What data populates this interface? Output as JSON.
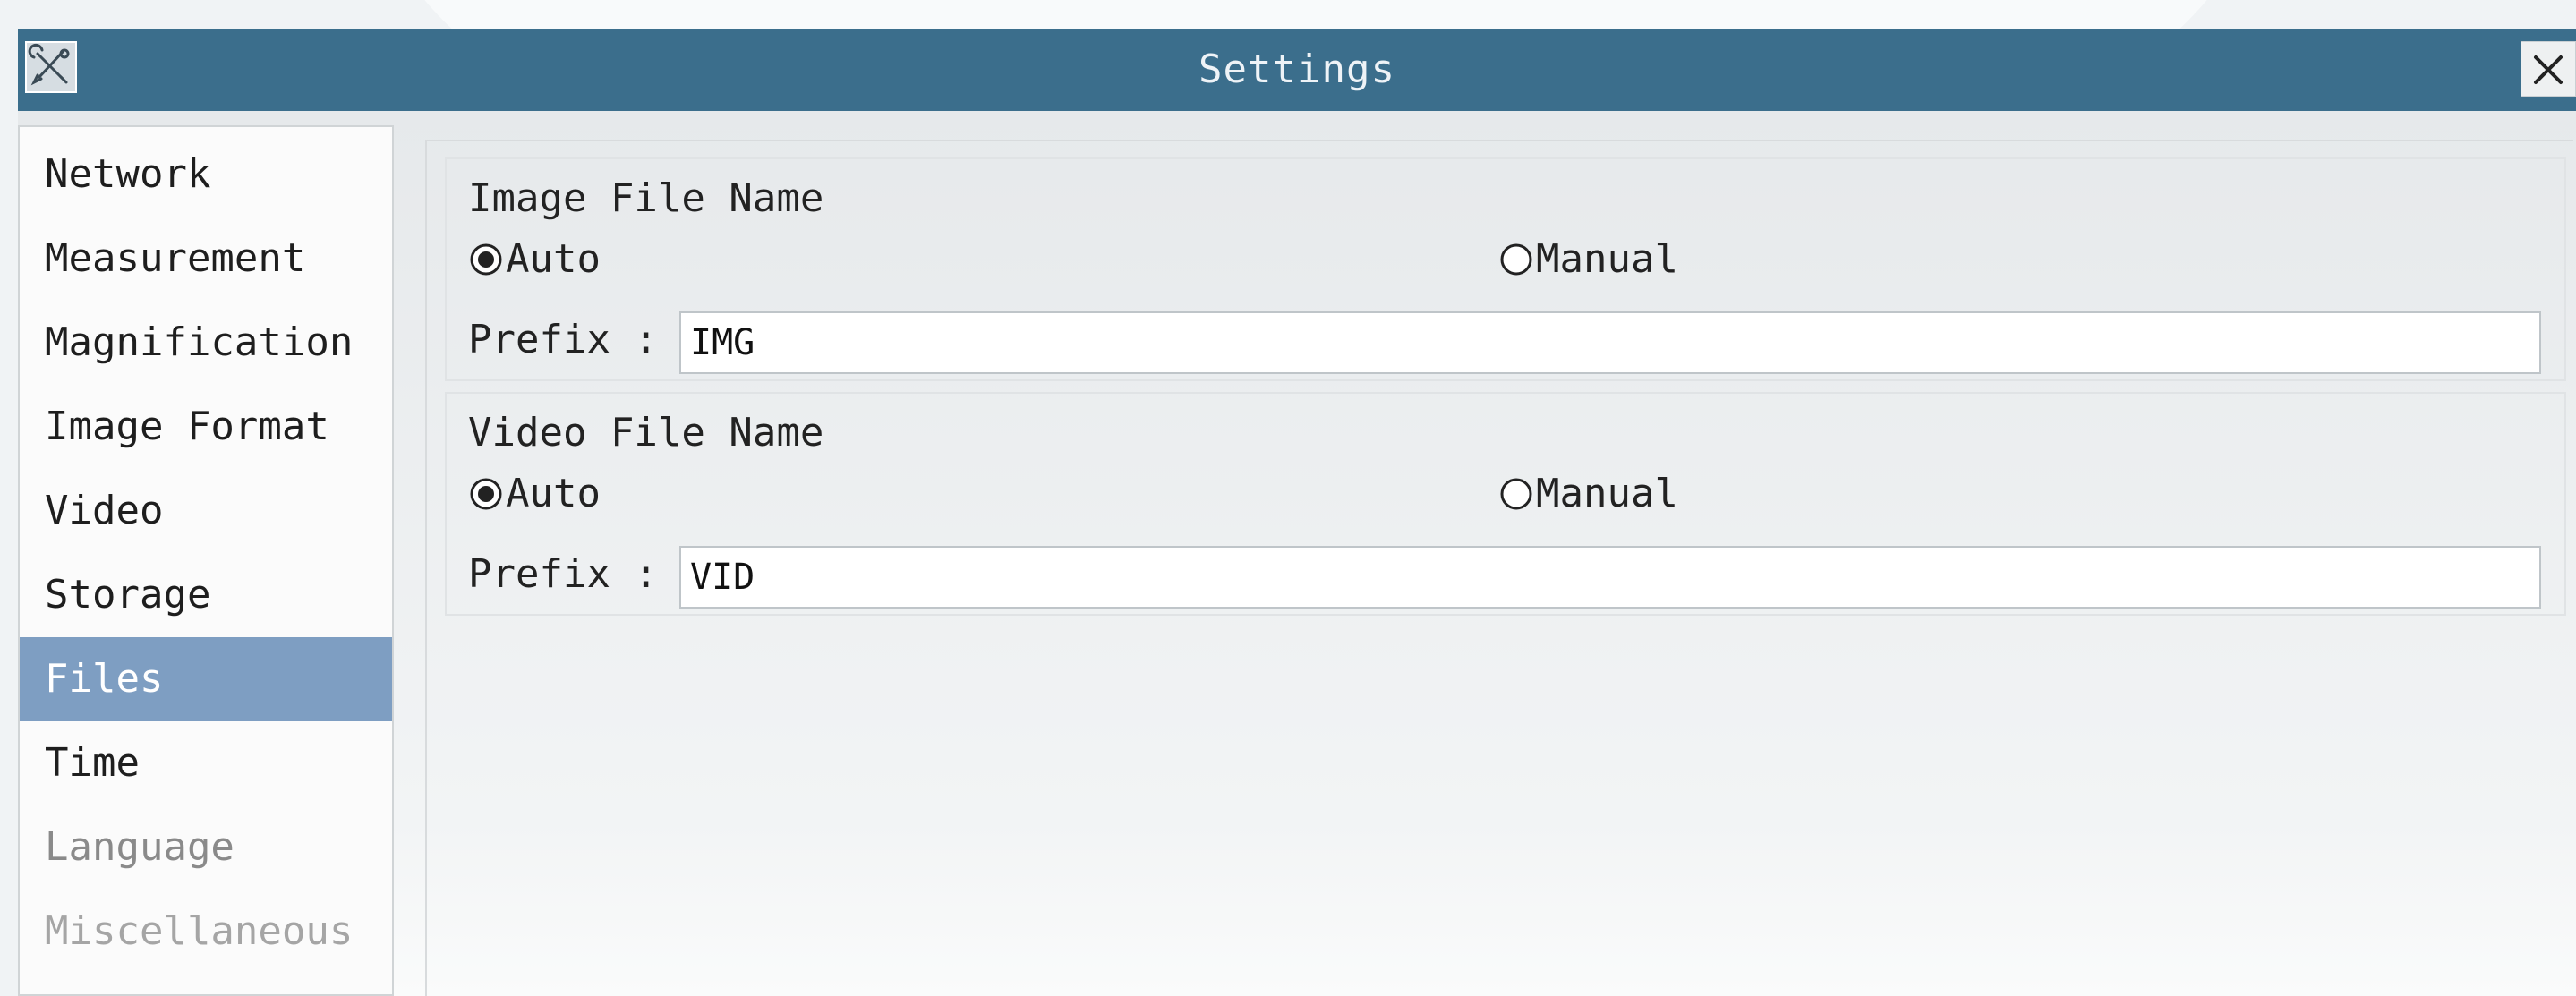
{
  "window": {
    "title": "Settings",
    "icon": "tools-icon",
    "close_icon": "close-icon"
  },
  "colors": {
    "titlebar": "#3b6e8c",
    "selected_item": "#7e9ec2"
  },
  "sidebar": {
    "items": [
      {
        "label": "Network"
      },
      {
        "label": "Measurement"
      },
      {
        "label": "Magnification"
      },
      {
        "label": "Image Format"
      },
      {
        "label": "Video"
      },
      {
        "label": "Storage"
      },
      {
        "label": "Files",
        "selected": true
      },
      {
        "label": "Time"
      },
      {
        "label": "Language"
      },
      {
        "label": "Miscellaneous"
      }
    ]
  },
  "image_file_name": {
    "title": "Image File Name",
    "auto_label": "Auto",
    "manual_label": "Manual",
    "selected": "Auto",
    "prefix_label": "Prefix :",
    "prefix_value": "IMG"
  },
  "video_file_name": {
    "title": "Video File Name",
    "auto_label": "Auto",
    "manual_label": "Manual",
    "selected": "Auto",
    "prefix_label": "Prefix :",
    "prefix_value": "VID"
  }
}
